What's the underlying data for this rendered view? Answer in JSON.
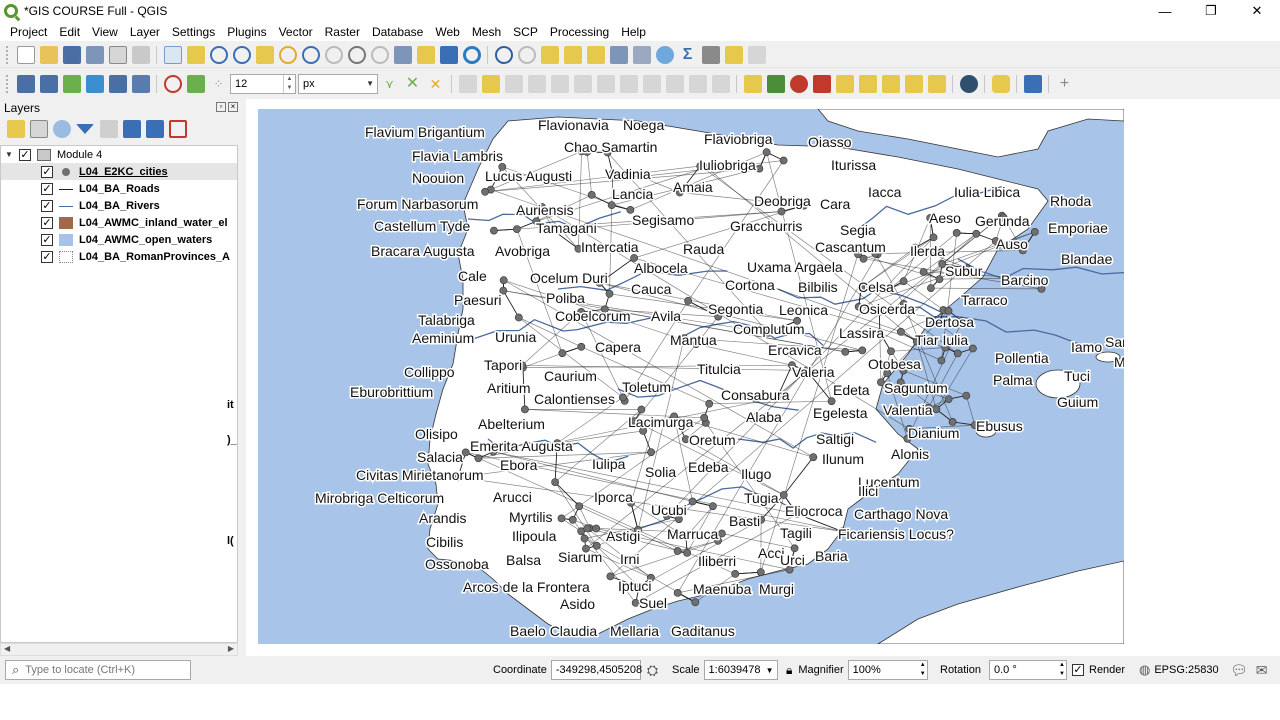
{
  "window": {
    "title": "*GIS COURSE Full - QGIS",
    "minimize": "—",
    "restore": "❐",
    "close": "✕"
  },
  "menu": [
    "Project",
    "Edit",
    "View",
    "Layer",
    "Settings",
    "Plugins",
    "Vector",
    "Raster",
    "Database",
    "Web",
    "Mesh",
    "SCP",
    "Processing",
    "Help"
  ],
  "toolbar2": {
    "size_value": "12",
    "unit_value": "px"
  },
  "layers_panel": {
    "title": "Layers",
    "group": "Module 4",
    "layers": [
      {
        "name": "L04_E2KC_cities",
        "symbol": "point",
        "color": "#6f6f6f",
        "checked": "✓"
      },
      {
        "name": "L04_BA_Roads",
        "symbol": "line",
        "color": "#222222",
        "checked": "✓"
      },
      {
        "name": "L04_BA_Rivers",
        "symbol": "line",
        "color": "#4a6a9e",
        "checked": "✓"
      },
      {
        "name": "L04_AWMC_inland_water_el",
        "symbol": "fill",
        "color": "#a0694a",
        "checked": "✓"
      },
      {
        "name": "L04_AWMC_open_waters",
        "symbol": "fill",
        "color": "#a6c2e8",
        "checked": "✓"
      },
      {
        "name": "L04_BA_RomanProvinces_A",
        "symbol": "fill",
        "color": "#ffffff",
        "checked": "✓"
      }
    ],
    "clip_fragments": [
      "it",
      ")_",
      "l("
    ]
  },
  "map": {
    "sea_color": "#a8c4e8",
    "land_color": "#ffffff",
    "labels": [
      "Flavium Brigantium",
      "Flavionavia",
      "Noega",
      "Flaviobriga",
      "Oiasso",
      "Flavia Lambris",
      "Chao Samartin",
      "Iuliobriga",
      "Iturissa",
      "Noouion",
      "Lucus Augusti",
      "Vadinia",
      "Amaia",
      "Iacca",
      "Iulia Libica",
      "Rhoda",
      "Forum Narbasorum",
      "Auriensis",
      "Lancia",
      "Deobriga",
      "Cara",
      "Aeso",
      "Gerunda",
      "Emporiae",
      "Castellum Tyde",
      "Tamagani",
      "Segisamo",
      "Gracchurris",
      "Segia",
      "Auso",
      "Bracara Augusta",
      "Avobriga",
      "Intercatia",
      "Rauda",
      "Cascantum",
      "Ilerda",
      "Blandae",
      "Cale",
      "Ocelum Duri",
      "Albocela",
      "Uxama Argaela",
      "Subur",
      "Barcino",
      "Paesuri",
      "Poliba",
      "Cauca",
      "Cortona",
      "Bilbilis",
      "Celsa",
      "Tarraco",
      "Talabriga",
      "Cobelcorum",
      "Avila",
      "Segontia",
      "Leonica",
      "Osicerda",
      "Dertosa",
      "Aeminium",
      "Urunia",
      "Complutum",
      "Lassira",
      "Tiar Iulia",
      "Iamo",
      "Sanisera",
      "Capera",
      "Mantua",
      "Ercavica",
      "Pollentia",
      "Mago",
      "Collippo",
      "Tapori",
      "Caurium",
      "Titulcia",
      "Valeria",
      "Otobesa",
      "Eburobrittium",
      "Aritium",
      "Toletum",
      "Edeta",
      "Saguntum",
      "Palma",
      "Tuci",
      "Calontienses",
      "Consabura",
      "Guium",
      "Abelterium",
      "Alaba",
      "Egelesta",
      "Valentia",
      "Lacimurga",
      "Olisipo",
      "Saltigi",
      "Dianium",
      "Ebusus",
      "Emerita Augusta",
      "Oretum",
      "Salacia",
      "Ilunum",
      "Ebora",
      "Iulipa",
      "Edeba",
      "Alonis",
      "Solia",
      "Civitas Mirietanorum",
      "Ilugo",
      "Lucentum",
      "Mirobriga Celticorum",
      "Arucci",
      "Iporca",
      "Tugia",
      "Ilici",
      "Arandis",
      "Myrtilis",
      "Ucubi",
      "Eliocroca",
      "Carthago Nova",
      "Ilipoula",
      "Basti",
      "Ficariensis Locus?",
      "Cibilis",
      "Astigi",
      "Marruca",
      "Tagili",
      "Ossonoba",
      "Balsa",
      "Siarum",
      "Irni",
      "Acci",
      "Baria",
      "Iliberri",
      "Urci",
      "Arcos de la Frontera",
      "Iptuci",
      "Maenuba",
      "Murgi",
      "Asido",
      "Suel",
      "Baelo Claudia",
      "Mellaria",
      "Gaditanus"
    ]
  },
  "status": {
    "locator_placeholder": "Type to locate (Ctrl+K)",
    "coordinate_label": "Coordinate",
    "coordinate_value": "-349298,4505208",
    "scale_label": "Scale",
    "scale_value": "1:6039478",
    "magnifier_label": "Magnifier",
    "magnifier_value": "100%",
    "rotation_label": "Rotation",
    "rotation_value": "0.0 °",
    "render_label": "Render",
    "render_checked": "✓",
    "crs": "EPSG:25830"
  }
}
